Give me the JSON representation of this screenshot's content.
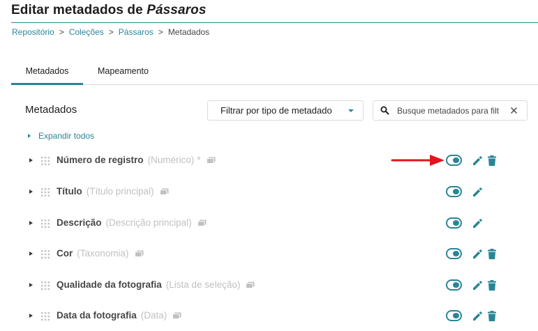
{
  "header": {
    "title_prefix": "Editar metadados de",
    "title_collection": "Pássaros"
  },
  "breadcrumb": {
    "items": [
      "Repositório",
      "Coleções",
      "Pássaros"
    ],
    "current": "Metadados",
    "separator": ">"
  },
  "tabs": [
    {
      "label": "Metadados",
      "active": true
    },
    {
      "label": "Mapeamento",
      "active": false
    }
  ],
  "section": {
    "title": "Metadados",
    "filter_label": "Filtrar por tipo de metadado",
    "search_placeholder": "Busque metadados para filt",
    "expand_all_label": "Expandir todos"
  },
  "metadata": [
    {
      "name": "Número de registro",
      "type": "(Numérico)",
      "required": "*",
      "enabled": true,
      "deletable": true
    },
    {
      "name": "Título",
      "type": "(Título principal)",
      "required": "",
      "enabled": true,
      "deletable": false
    },
    {
      "name": "Descrição",
      "type": "(Descrição principal)",
      "required": "",
      "enabled": true,
      "deletable": false
    },
    {
      "name": "Cor",
      "type": "(Taxonomia)",
      "required": "",
      "enabled": true,
      "deletable": true
    },
    {
      "name": "Qualidade da fotografia",
      "type": "(Lista de seleção)",
      "required": "",
      "enabled": true,
      "deletable": true
    },
    {
      "name": "Data da fotografia",
      "type": "(Data)",
      "required": "",
      "enabled": true,
      "deletable": true
    }
  ],
  "colors": {
    "accent": "#298596",
    "text_dark": "#1d1d1d",
    "text_muted": "#c1c1c1",
    "annotation_arrow": "#e4141b"
  },
  "icons": {
    "row_expand": "chevron-right-icon",
    "drag": "drag-handle-icon",
    "collection": "folder-icon",
    "toggle": "toggle-icon",
    "edit": "pencil-icon",
    "delete": "trash-icon",
    "search": "search-icon",
    "clear": "close-icon"
  }
}
